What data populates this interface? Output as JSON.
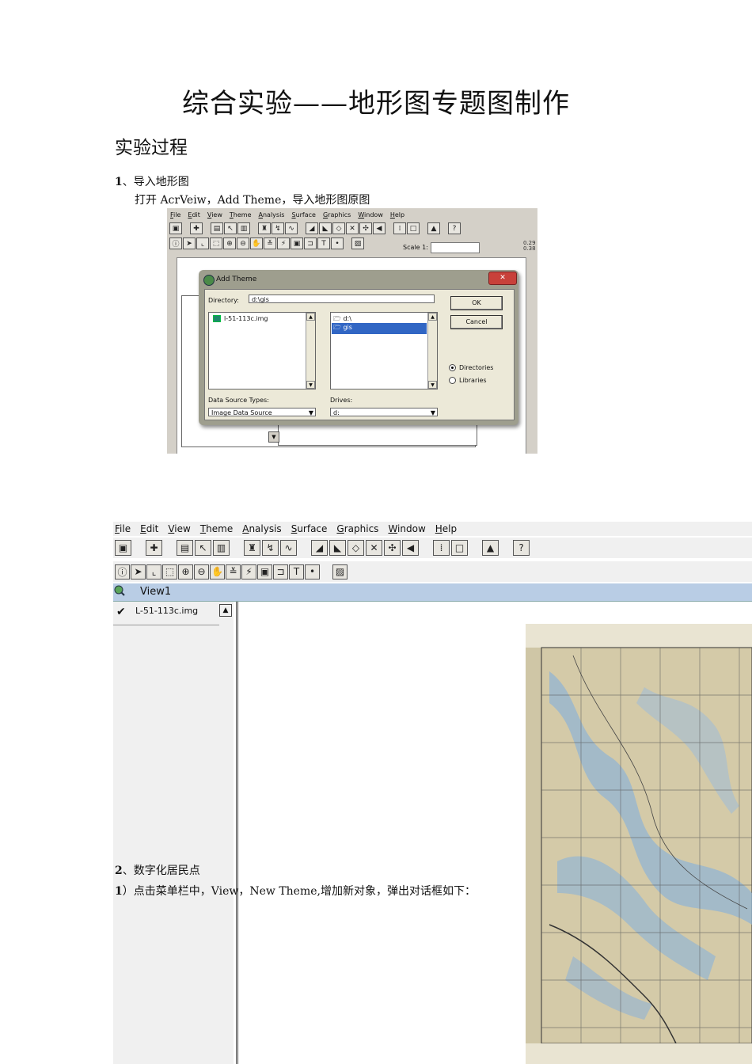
{
  "document": {
    "title": "综合实验——地形图专题图制作",
    "section_heading": "实验过程",
    "step1": {
      "num": "1",
      "text": "、导入地形图"
    },
    "step1_desc": "打开 AcrVeiw，Add Theme，导入地形图原图",
    "step2": {
      "num": "2",
      "text": "、数字化居民点"
    },
    "step2_desc": {
      "num": "1",
      "text": "）点击菜单栏中，View，New Theme,增加新对象，弹出对话框如下："
    }
  },
  "screenshot1": {
    "menu": [
      "File",
      "Edit",
      "View",
      "Theme",
      "Analysis",
      "Surface",
      "Graphics",
      "Window",
      "Help"
    ],
    "scale_label": "Scale 1:",
    "coords": [
      "0.29",
      "0.38"
    ],
    "dialog": {
      "title": "Add Theme",
      "close_label": "✕",
      "directory_label": "Directory:",
      "directory_value": "d:\\gis",
      "files": [
        "l-51-113c.img"
      ],
      "folders": [
        "d:\\",
        "gis"
      ],
      "ok_label": "OK",
      "cancel_label": "Cancel",
      "radio_directories": "Directories",
      "radio_libraries": "Libraries",
      "data_source_label": "Data Source Types:",
      "data_source_value": "Image Data Source",
      "drives_label": "Drives:",
      "drives_value": "d:"
    }
  },
  "screenshot2": {
    "menu": [
      "File",
      "Edit",
      "View",
      "Theme",
      "Analysis",
      "Surface",
      "Graphics",
      "Window",
      "Help"
    ],
    "view_title": "View1",
    "layer_name": "L-51-113c.img",
    "colors": {
      "viewbar": "#b9cde5",
      "map_base": "#cfc6a6",
      "water": "#8fb3d6"
    }
  }
}
